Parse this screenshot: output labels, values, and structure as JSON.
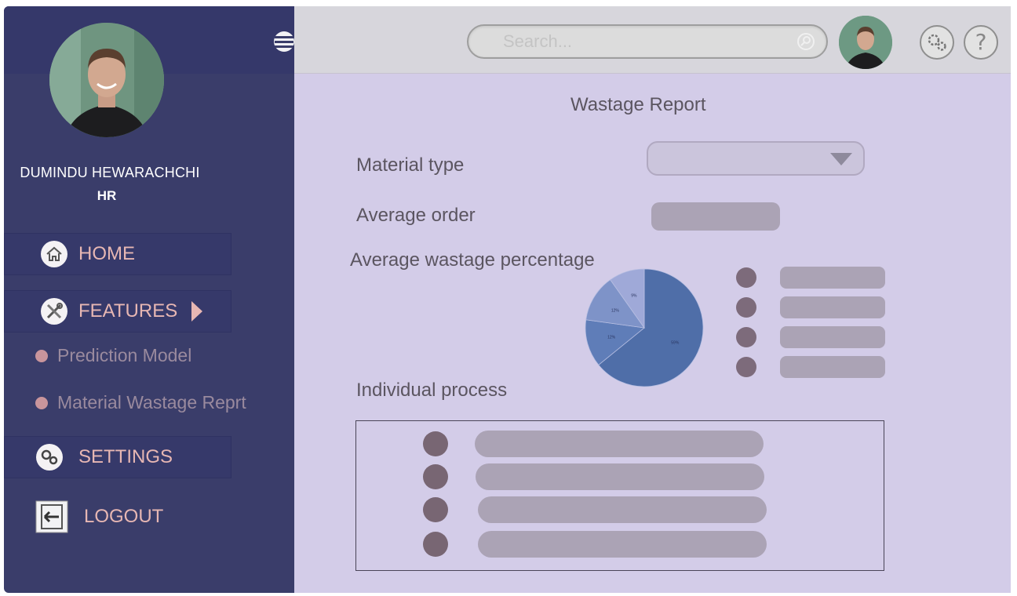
{
  "sidebar": {
    "user_name": "DUMINDU HEWARACHCHI",
    "user_role": "HR",
    "nav": {
      "home": "HOME",
      "features": "FEATURES",
      "sub_items": [
        "Prediction Model",
        "Material Wastage Reprt"
      ],
      "settings": "SETTINGS",
      "logout": "LOGOUT"
    }
  },
  "header": {
    "search_placeholder": "Search..."
  },
  "report": {
    "title": "Wastage Report",
    "material_type_label": "Material  type",
    "average_order_label": "Average order",
    "average_wastage_label": "Average wastage percentage",
    "individual_process_label": "Individual process"
  },
  "pie": {
    "slices": [
      {
        "value": 59,
        "label": "59%",
        "color": "#4f6ea8"
      },
      {
        "value": 12,
        "label": "12%",
        "color": "#5f7db8"
      },
      {
        "value": 12,
        "label": "12%",
        "color": "#7e93c8"
      },
      {
        "value": 9,
        "label": "9%",
        "color": "#9fa9d8"
      }
    ]
  },
  "colors": {
    "sidebar_bg": "#3a3d6a",
    "main_bg": "#d3cce8",
    "nav_text": "#e7b7b3",
    "placeholder_bar": "#aba3b5",
    "marker": "#7d6b7b"
  }
}
